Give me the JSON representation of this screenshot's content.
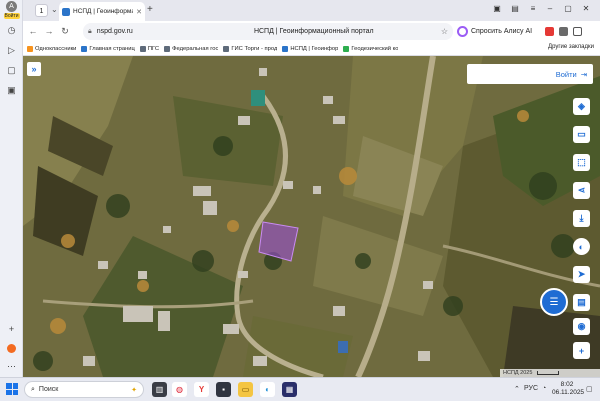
{
  "browser": {
    "rail": {
      "login_label": "Войти",
      "avatar_letter": "A"
    },
    "tab_count": "1",
    "tab_title": "НСПД | Геоинформацио",
    "url": "nspd.gov.ru",
    "page_title": "НСПД | Геоинформационный портал",
    "alice_label": "Спросить Алису AI",
    "bookmarks": [
      {
        "label": "Одноклассники",
        "color": "#f7931e"
      },
      {
        "label": "Главная страниц",
        "color": "#2b74c9"
      },
      {
        "label": "ПГС",
        "color": "#5f6b7a"
      },
      {
        "label": "Федеральная гос",
        "color": "#5f6b7a"
      },
      {
        "label": "ГИС Торги - прод",
        "color": "#5f6b7a"
      },
      {
        "label": "НСПД | Геоинфор",
        "color": "#2b74c9"
      },
      {
        "label": "Геодезический ко",
        "color": "#2eae4f"
      }
    ],
    "other_bookmarks": "Другие закладки"
  },
  "map": {
    "login_label": "Войти",
    "attribution": "НСПД 2025",
    "accent_color": "#1f6cd3"
  },
  "taskbar": {
    "search_placeholder": "Поиск",
    "language": "РУС",
    "time": "8:02",
    "date": "06.11.2025"
  }
}
